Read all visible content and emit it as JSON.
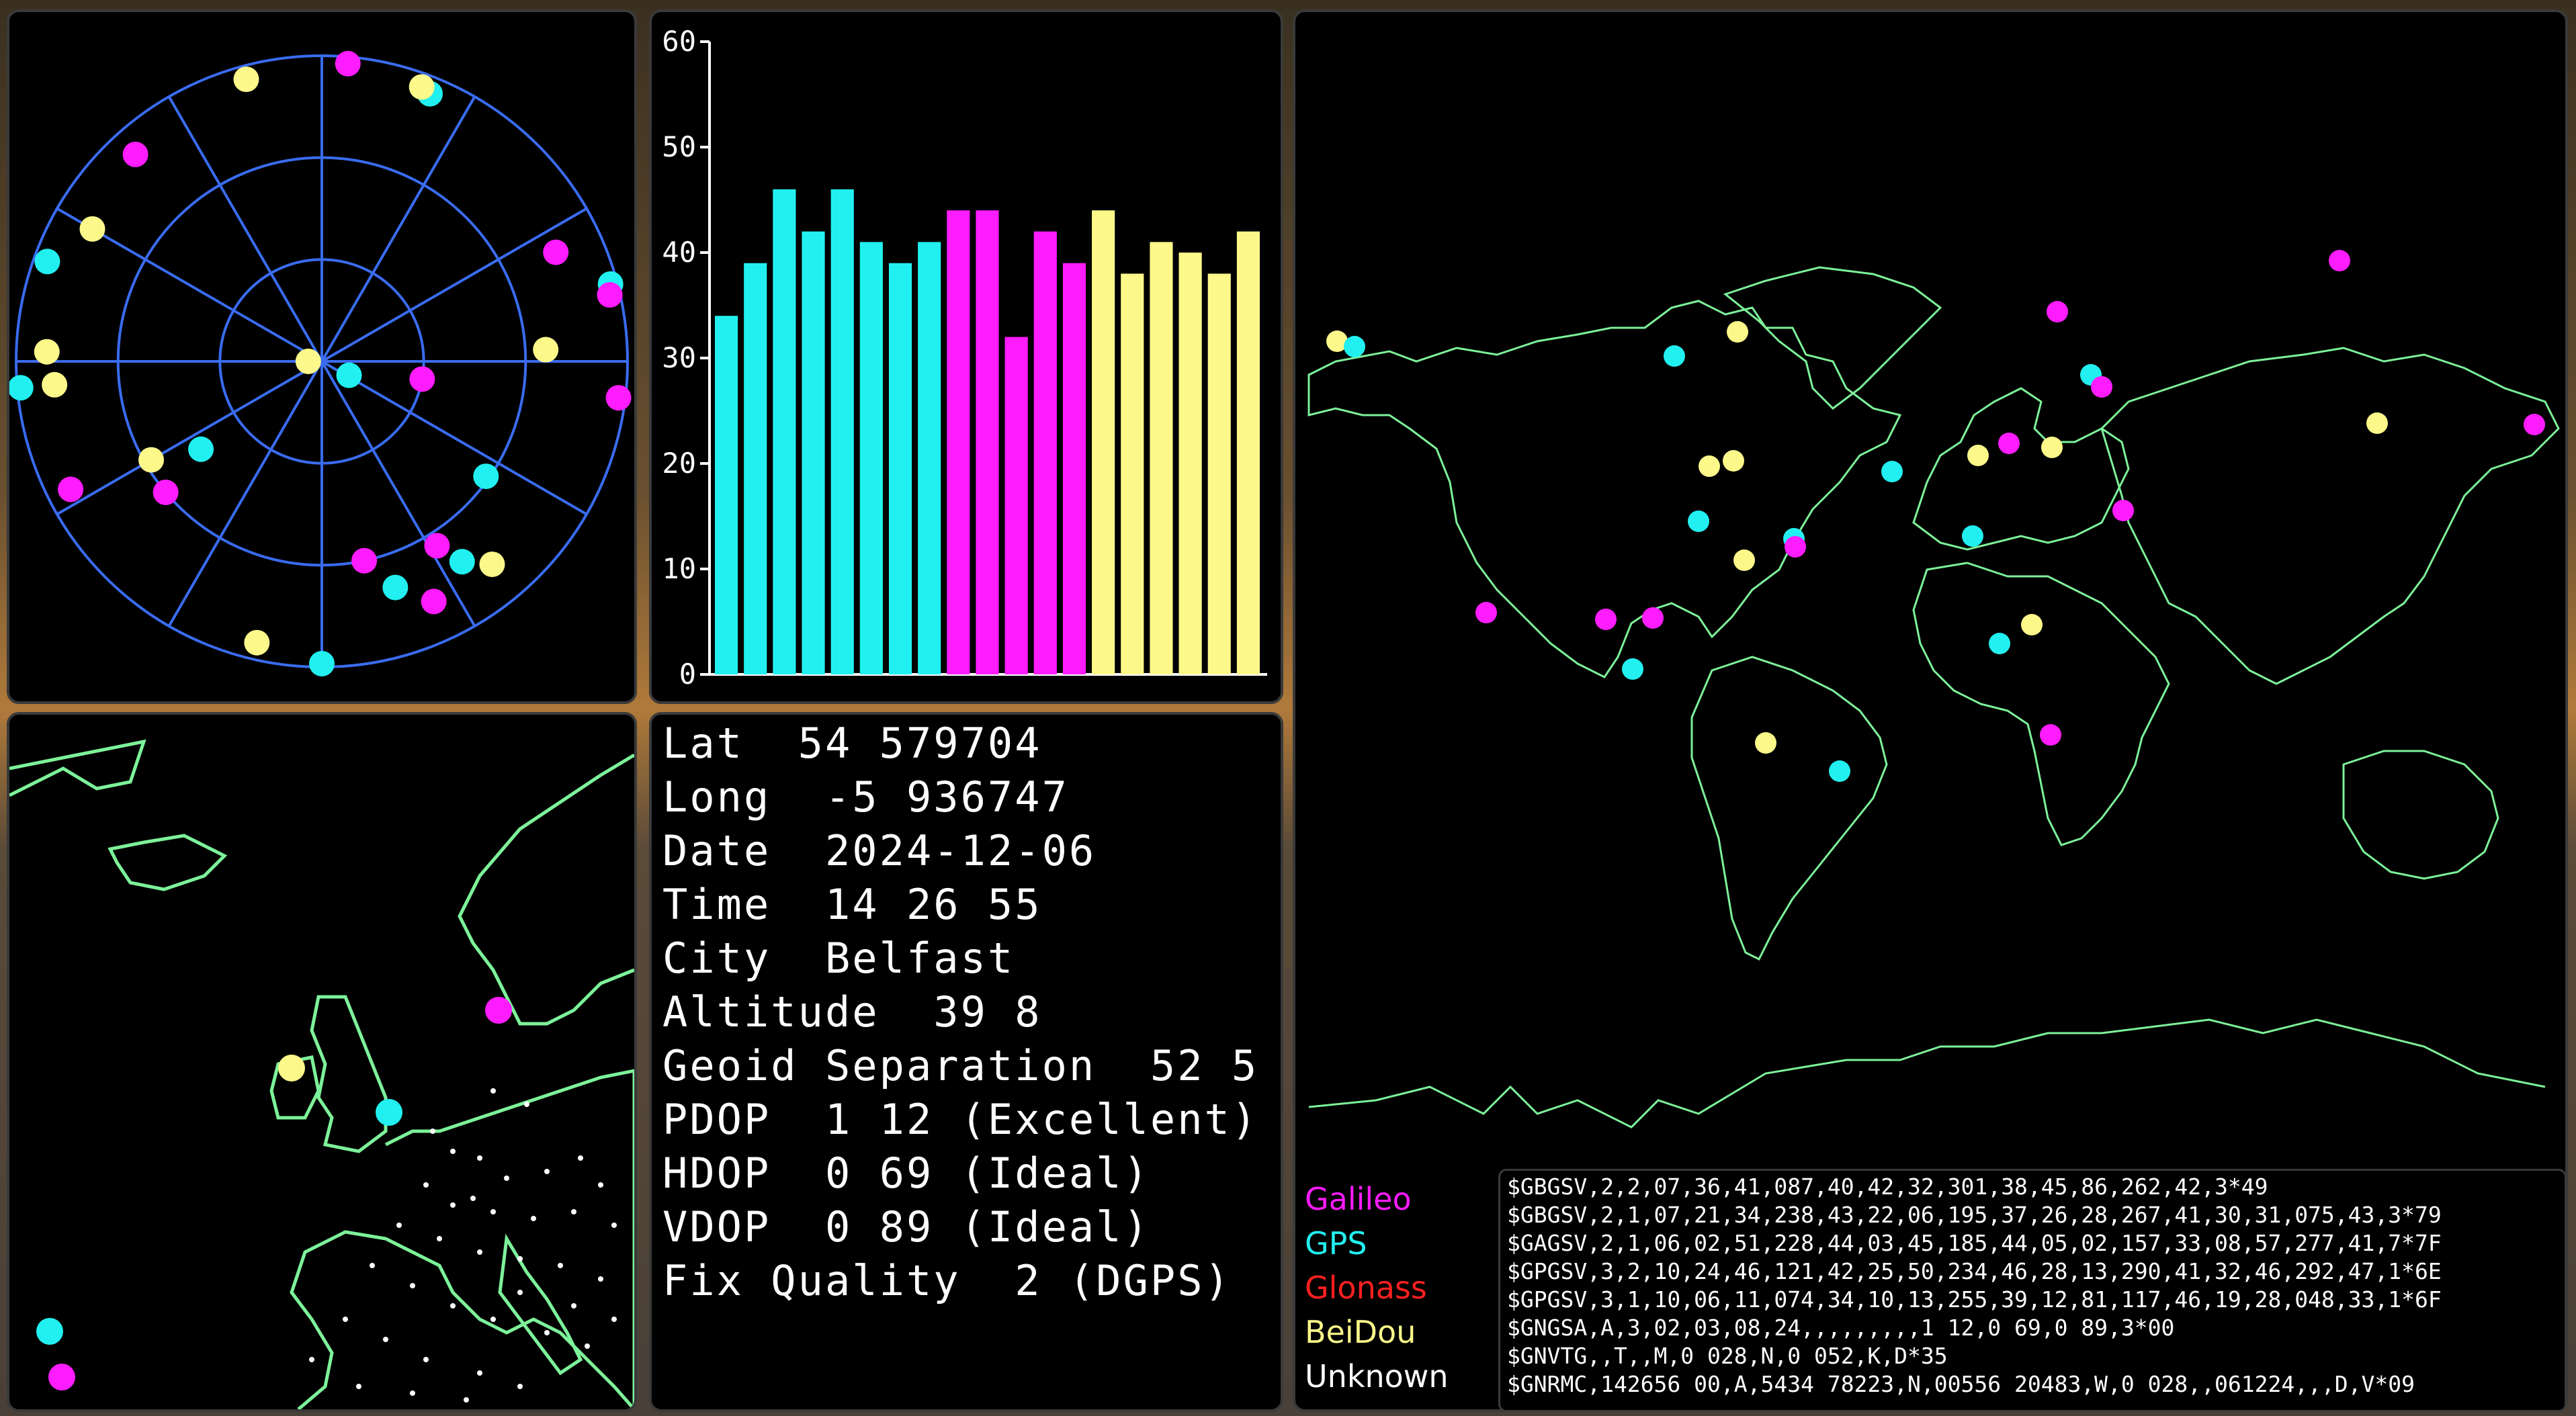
{
  "colors": {
    "galileo": "#ff1cff",
    "gps": "#22f0f0",
    "glonass": "#ff2020",
    "beidou": "#fcf88a",
    "unknown": "#ffffff",
    "grid": "#3a6cf0",
    "land": "#7df29a"
  },
  "info": {
    "lat": "Lat  54 579704",
    "long": "Long  -5 936747",
    "date": "Date  2024-12-06",
    "time": "Time  14 26 55",
    "city": "City  Belfast",
    "altitude": "Altitude  39 8",
    "geoid": "Geoid Separation  52 5",
    "pdop": "PDOP  1 12 (Excellent)",
    "hdop": "HDOP  0 69 (Ideal)",
    "vdop": "VDOP  0 89 (Ideal)",
    "fix": "Fix Quality  2 (DGPS)"
  },
  "legend": {
    "galileo": "Galileo",
    "gps": "GPS",
    "glonass": "Glonass",
    "beidou": "BeiDou",
    "unknown": "Unknown"
  },
  "nmea": [
    "$GBGSV,2,2,07,36,41,087,40,42,32,301,38,45,86,262,42,3*49",
    "$GBGSV,2,1,07,21,34,238,43,22,06,195,37,26,28,267,41,30,31,075,43,3*79",
    "$GAGSV,2,1,06,02,51,228,44,03,45,185,44,05,02,157,33,08,57,277,41,7*7F",
    "$GPGSV,3,2,10,24,46,121,42,25,50,234,46,28,13,290,41,32,46,292,47,1*6E",
    "$GPGSV,3,1,10,06,11,074,34,10,13,255,39,12,81,117,46,19,28,048,33,1*6F",
    "$GNGSA,A,3,02,03,08,24,,,,,,,,,1 12,0 69,0 89,3*00",
    "$GNVTG,,T,,M,0 028,N,0 052,K,D*35",
    "$GNRMC,142656 00,A,5434 78223,N,00556 20483,W,0 028,,061224,,,D,V*09"
  ],
  "chart_data": {
    "type": "bar",
    "ylim": [
      0,
      60
    ],
    "yticks": [
      "0",
      "10",
      "20",
      "30",
      "40",
      "50",
      "60"
    ],
    "values": [
      34,
      39,
      46,
      42,
      46,
      41,
      39,
      41,
      44,
      44,
      32,
      42,
      39,
      44,
      38,
      41,
      40,
      38,
      42
    ],
    "constellations": [
      "gps",
      "gps",
      "gps",
      "gps",
      "gps",
      "gps",
      "gps",
      "gps",
      "galileo",
      "galileo",
      "galileo",
      "galileo",
      "galileo",
      "beidou",
      "beidou",
      "beidou",
      "beidou",
      "beidou",
      "beidou"
    ]
  },
  "sky": {
    "satellites": [
      {
        "az": 5,
        "el": 2,
        "c": "galileo"
      },
      {
        "az": 345,
        "el": 4,
        "c": "beidou"
      },
      {
        "az": 22,
        "el": 5,
        "c": "gps"
      },
      {
        "az": 20,
        "el": 4,
        "c": "beidou"
      },
      {
        "az": 318,
        "el": 8,
        "c": "galileo"
      },
      {
        "az": 300,
        "el": 12,
        "c": "beidou"
      },
      {
        "az": 290,
        "el": 4,
        "c": "gps"
      },
      {
        "az": 65,
        "el": 14,
        "c": "galileo"
      },
      {
        "az": 75,
        "el": 2,
        "c": "gps"
      },
      {
        "az": 77,
        "el": 3,
        "c": "galileo"
      },
      {
        "az": 87,
        "el": 24,
        "c": "beidou"
      },
      {
        "az": 97,
        "el": 2,
        "c": "galileo"
      },
      {
        "az": 100,
        "el": 60,
        "c": "galileo"
      },
      {
        "az": 265,
        "el": 11,
        "c": "beidou"
      },
      {
        "az": 272,
        "el": 9,
        "c": "beidou"
      },
      {
        "az": 265,
        "el": 1,
        "c": "gps"
      },
      {
        "az": 117,
        "el": 81,
        "c": "gps"
      },
      {
        "az": 125,
        "el": 31,
        "c": "gps"
      },
      {
        "az": 140,
        "el": 12,
        "c": "beidou"
      },
      {
        "az": 145,
        "el": 18,
        "c": "gps"
      },
      {
        "az": 148,
        "el": 26,
        "c": "galileo"
      },
      {
        "az": 168,
        "el": 30,
        "c": "galileo"
      },
      {
        "az": 155,
        "el": 12,
        "c": "galileo"
      },
      {
        "az": 162,
        "el": 20,
        "c": "gps"
      },
      {
        "az": 180,
        "el": 1,
        "c": "gps"
      },
      {
        "az": 193,
        "el": 5,
        "c": "beidou"
      },
      {
        "az": 230,
        "el": 30,
        "c": "galileo"
      },
      {
        "az": 234,
        "el": 46,
        "c": "gps"
      },
      {
        "az": 240,
        "el": 32,
        "c": "beidou"
      },
      {
        "az": 243,
        "el": 7,
        "c": "galileo"
      },
      {
        "az": 270,
        "el": 86,
        "c": "beidou"
      }
    ]
  }
}
